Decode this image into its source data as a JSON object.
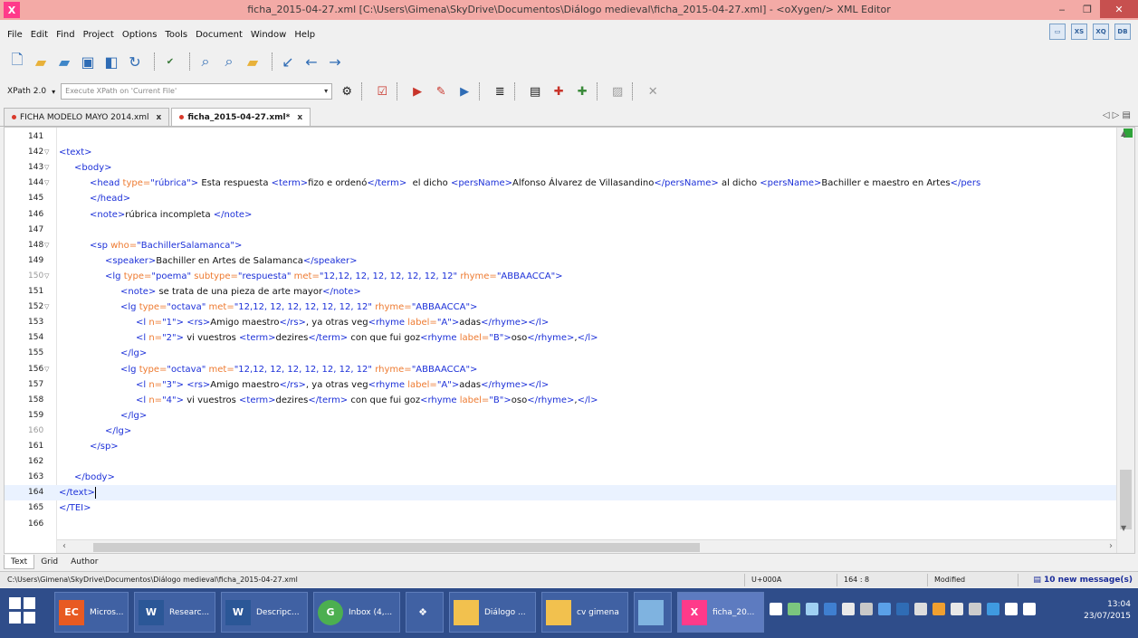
{
  "window": {
    "title": "ficha_2015-04-27.xml [C:\\Users\\Gimena\\SkyDrive\\Documentos\\Diálogo medieval\\ficha_2015-04-27.xml] - <oXygen/> XML Editor",
    "app_icon": "X"
  },
  "menu": [
    "File",
    "Edit",
    "Find",
    "Project",
    "Options",
    "Tools",
    "Document",
    "Window",
    "Help"
  ],
  "xpath": {
    "version": "XPath 2.0",
    "placeholder": "Execute XPath on 'Current File'"
  },
  "tabs": [
    {
      "label": "FICHA MODELO MAYO 2014.xml",
      "close": "x"
    },
    {
      "label": "ficha_2015-04-27.xml*",
      "close": "x"
    }
  ],
  "editor": {
    "lines": [
      {
        "n": "141",
        "fold": "",
        "indent": 0,
        "parts": []
      },
      {
        "n": "142",
        "fold": "▽",
        "indent": 0,
        "parts": [
          {
            "c": "t",
            "s": "<text>"
          }
        ]
      },
      {
        "n": "143",
        "fold": "▽",
        "indent": 1,
        "parts": [
          {
            "c": "t",
            "s": "<body>"
          }
        ]
      },
      {
        "n": "144",
        "fold": "▽",
        "indent": 2,
        "parts": [
          {
            "c": "t",
            "s": "<head "
          },
          {
            "c": "a",
            "s": "type="
          },
          {
            "c": "v",
            "s": "\"rúbrica\""
          },
          {
            "c": "t",
            "s": ">"
          },
          {
            "c": "x",
            "s": " Esta respuesta "
          },
          {
            "c": "t",
            "s": "<term>"
          },
          {
            "c": "x",
            "s": "fizo e ordenó"
          },
          {
            "c": "t",
            "s": "</term>"
          },
          {
            "c": "x",
            "s": "  el dicho "
          },
          {
            "c": "t",
            "s": "<persName>"
          },
          {
            "c": "x",
            "s": "Alfonso Álvarez de Villasandino"
          },
          {
            "c": "t",
            "s": "</persName>"
          },
          {
            "c": "x",
            "s": " al dicho "
          },
          {
            "c": "t",
            "s": "<persName>"
          },
          {
            "c": "x",
            "s": "Bachiller e maestro en Artes"
          },
          {
            "c": "t",
            "s": "</pers"
          }
        ]
      },
      {
        "n": "145",
        "fold": "",
        "indent": 2,
        "parts": [
          {
            "c": "t",
            "s": "</head>"
          }
        ]
      },
      {
        "n": "146",
        "fold": "",
        "indent": 2,
        "parts": [
          {
            "c": "t",
            "s": "<note>"
          },
          {
            "c": "x",
            "s": "rúbrica incompleta "
          },
          {
            "c": "t",
            "s": "</note>"
          }
        ]
      },
      {
        "n": "147",
        "fold": "",
        "indent": 0,
        "parts": []
      },
      {
        "n": "148",
        "fold": "▽",
        "indent": 2,
        "parts": [
          {
            "c": "t",
            "s": "<sp "
          },
          {
            "c": "a",
            "s": "who="
          },
          {
            "c": "v",
            "s": "\"BachillerSalamanca\""
          },
          {
            "c": "t",
            "s": ">"
          }
        ]
      },
      {
        "n": "149",
        "fold": "",
        "indent": 3,
        "parts": [
          {
            "c": "t",
            "s": "<speaker>"
          },
          {
            "c": "x",
            "s": "Bachiller en Artes de Salamanca"
          },
          {
            "c": "t",
            "s": "</speaker>"
          }
        ]
      },
      {
        "n": "150",
        "fold": "▽",
        "indent": 3,
        "gray": true,
        "parts": [
          {
            "c": "t",
            "s": "<lg "
          },
          {
            "c": "a",
            "s": "type="
          },
          {
            "c": "v",
            "s": "\"poema\""
          },
          {
            "c": "a",
            "s": " subtype="
          },
          {
            "c": "v",
            "s": "\"respuesta\""
          },
          {
            "c": "a",
            "s": " met="
          },
          {
            "c": "v",
            "s": "\"12,12, 12, 12, 12, 12, 12, 12\""
          },
          {
            "c": "a",
            "s": " rhyme="
          },
          {
            "c": "v",
            "s": "\"ABBAACCA\""
          },
          {
            "c": "t",
            "s": ">"
          }
        ]
      },
      {
        "n": "151",
        "fold": "",
        "indent": 4,
        "parts": [
          {
            "c": "t",
            "s": "<note>"
          },
          {
            "c": "x",
            "s": " se trata de una pieza de arte mayor"
          },
          {
            "c": "t",
            "s": "</note>"
          }
        ]
      },
      {
        "n": "152",
        "fold": "▽",
        "indent": 4,
        "parts": [
          {
            "c": "t",
            "s": "<lg "
          },
          {
            "c": "a",
            "s": "type="
          },
          {
            "c": "v",
            "s": "\"octava\""
          },
          {
            "c": "a",
            "s": " met="
          },
          {
            "c": "v",
            "s": "\"12,12, 12, 12, 12, 12, 12, 12\""
          },
          {
            "c": "a",
            "s": " rhyme="
          },
          {
            "c": "v",
            "s": "\"ABBAACCA\""
          },
          {
            "c": "t",
            "s": ">"
          }
        ]
      },
      {
        "n": "153",
        "fold": "",
        "indent": 5,
        "parts": [
          {
            "c": "t",
            "s": "<l "
          },
          {
            "c": "a",
            "s": "n="
          },
          {
            "c": "v",
            "s": "\"1\""
          },
          {
            "c": "t",
            "s": ">"
          },
          {
            "c": "x",
            "s": " "
          },
          {
            "c": "t",
            "s": "<rs>"
          },
          {
            "c": "x",
            "s": "Amigo maestro"
          },
          {
            "c": "t",
            "s": "</rs>"
          },
          {
            "c": "x",
            "s": ", ya otras veg"
          },
          {
            "c": "t",
            "s": "<rhyme "
          },
          {
            "c": "a",
            "s": "label="
          },
          {
            "c": "v",
            "s": "\"A\""
          },
          {
            "c": "t",
            "s": ">"
          },
          {
            "c": "x",
            "s": "adas"
          },
          {
            "c": "t",
            "s": "</rhyme></l>"
          }
        ]
      },
      {
        "n": "154",
        "fold": "",
        "indent": 5,
        "parts": [
          {
            "c": "t",
            "s": "<l "
          },
          {
            "c": "a",
            "s": "n="
          },
          {
            "c": "v",
            "s": "\"2\""
          },
          {
            "c": "t",
            "s": ">"
          },
          {
            "c": "x",
            "s": " vi vuestros "
          },
          {
            "c": "t",
            "s": "<term>"
          },
          {
            "c": "x",
            "s": "dezires"
          },
          {
            "c": "t",
            "s": "</term>"
          },
          {
            "c": "x",
            "s": " con que fui goz"
          },
          {
            "c": "t",
            "s": "<rhyme "
          },
          {
            "c": "a",
            "s": "label="
          },
          {
            "c": "v",
            "s": "\"B\""
          },
          {
            "c": "t",
            "s": ">"
          },
          {
            "c": "x",
            "s": "oso"
          },
          {
            "c": "t",
            "s": "</rhyme>"
          },
          {
            "c": "x",
            "s": ","
          },
          {
            "c": "t",
            "s": "</l>"
          }
        ]
      },
      {
        "n": "155",
        "fold": "",
        "indent": 4,
        "parts": [
          {
            "c": "t",
            "s": "</lg>"
          }
        ]
      },
      {
        "n": "156",
        "fold": "▽",
        "indent": 4,
        "parts": [
          {
            "c": "t",
            "s": "<lg "
          },
          {
            "c": "a",
            "s": "type="
          },
          {
            "c": "v",
            "s": "\"octava\""
          },
          {
            "c": "a",
            "s": " met="
          },
          {
            "c": "v",
            "s": "\"12,12, 12, 12, 12, 12, 12, 12\""
          },
          {
            "c": "a",
            "s": " rhyme="
          },
          {
            "c": "v",
            "s": "\"ABBAACCA\""
          },
          {
            "c": "t",
            "s": ">"
          }
        ]
      },
      {
        "n": "157",
        "fold": "",
        "indent": 5,
        "parts": [
          {
            "c": "t",
            "s": "<l "
          },
          {
            "c": "a",
            "s": "n="
          },
          {
            "c": "v",
            "s": "\"3\""
          },
          {
            "c": "t",
            "s": ">"
          },
          {
            "c": "x",
            "s": " "
          },
          {
            "c": "t",
            "s": "<rs>"
          },
          {
            "c": "x",
            "s": "Amigo maestro"
          },
          {
            "c": "t",
            "s": "</rs>"
          },
          {
            "c": "x",
            "s": ", ya otras veg"
          },
          {
            "c": "t",
            "s": "<rhyme "
          },
          {
            "c": "a",
            "s": "label="
          },
          {
            "c": "v",
            "s": "\"A\""
          },
          {
            "c": "t",
            "s": ">"
          },
          {
            "c": "x",
            "s": "adas"
          },
          {
            "c": "t",
            "s": "</rhyme></l>"
          }
        ]
      },
      {
        "n": "158",
        "fold": "",
        "indent": 5,
        "parts": [
          {
            "c": "t",
            "s": "<l "
          },
          {
            "c": "a",
            "s": "n="
          },
          {
            "c": "v",
            "s": "\"4\""
          },
          {
            "c": "t",
            "s": ">"
          },
          {
            "c": "x",
            "s": " vi vuestros "
          },
          {
            "c": "t",
            "s": "<term>"
          },
          {
            "c": "x",
            "s": "dezires"
          },
          {
            "c": "t",
            "s": "</term>"
          },
          {
            "c": "x",
            "s": " con que fui goz"
          },
          {
            "c": "t",
            "s": "<rhyme "
          },
          {
            "c": "a",
            "s": "label="
          },
          {
            "c": "v",
            "s": "\"B\""
          },
          {
            "c": "t",
            "s": ">"
          },
          {
            "c": "x",
            "s": "oso"
          },
          {
            "c": "t",
            "s": "</rhyme>"
          },
          {
            "c": "x",
            "s": ","
          },
          {
            "c": "t",
            "s": "</l>"
          }
        ]
      },
      {
        "n": "159",
        "fold": "",
        "indent": 4,
        "parts": [
          {
            "c": "t",
            "s": "</lg>"
          }
        ]
      },
      {
        "n": "160",
        "fold": "",
        "indent": 3,
        "gray": true,
        "parts": [
          {
            "c": "t",
            "s": "</lg>"
          }
        ]
      },
      {
        "n": "161",
        "fold": "",
        "indent": 2,
        "parts": [
          {
            "c": "t",
            "s": "</sp>"
          }
        ]
      },
      {
        "n": "162",
        "fold": "",
        "indent": 0,
        "parts": []
      },
      {
        "n": "163",
        "fold": "",
        "indent": 1,
        "parts": [
          {
            "c": "t",
            "s": "</body>"
          }
        ]
      },
      {
        "n": "164",
        "fold": "",
        "indent": 0,
        "current": true,
        "parts": [
          {
            "c": "t",
            "s": "</text>"
          }
        ]
      },
      {
        "n": "165",
        "fold": "",
        "indent": 0,
        "parts": [
          {
            "c": "t",
            "s": "</TEI>"
          }
        ]
      },
      {
        "n": "166",
        "fold": "",
        "indent": 0,
        "parts": []
      }
    ]
  },
  "modes": [
    "Text",
    "Grid",
    "Author"
  ],
  "status": {
    "path": "C:\\Users\\Gimena\\SkyDrive\\Documentos\\Diálogo medieval\\ficha_2015-04-27.xml",
    "unicode": "U+000A",
    "position": "164 : 8",
    "state": "Modified",
    "messages": "10 new message(s)"
  },
  "taskbar": {
    "items": [
      {
        "label": "Micros...",
        "icon": "EC"
      },
      {
        "label": "Researc...",
        "icon": "W"
      },
      {
        "label": "Descripc...",
        "icon": "W"
      },
      {
        "label": "Inbox (4,...",
        "icon": "G"
      },
      {
        "label": "",
        "icon": "dropbox-icon"
      },
      {
        "label": "Diálogo ...",
        "icon": "folder-icon"
      },
      {
        "label": "cv gimena",
        "icon": "folder-icon"
      },
      {
        "label": "",
        "icon": "app-icon"
      },
      {
        "label": "ficha_20...",
        "icon": "X"
      }
    ],
    "time": "13:04",
    "date": "23/07/2015"
  },
  "colors": {
    "titlebar": "#f3aaa6",
    "tag": "#1c30d8",
    "attr": "#ee7a30",
    "taskbar": "#2f4d8a"
  }
}
